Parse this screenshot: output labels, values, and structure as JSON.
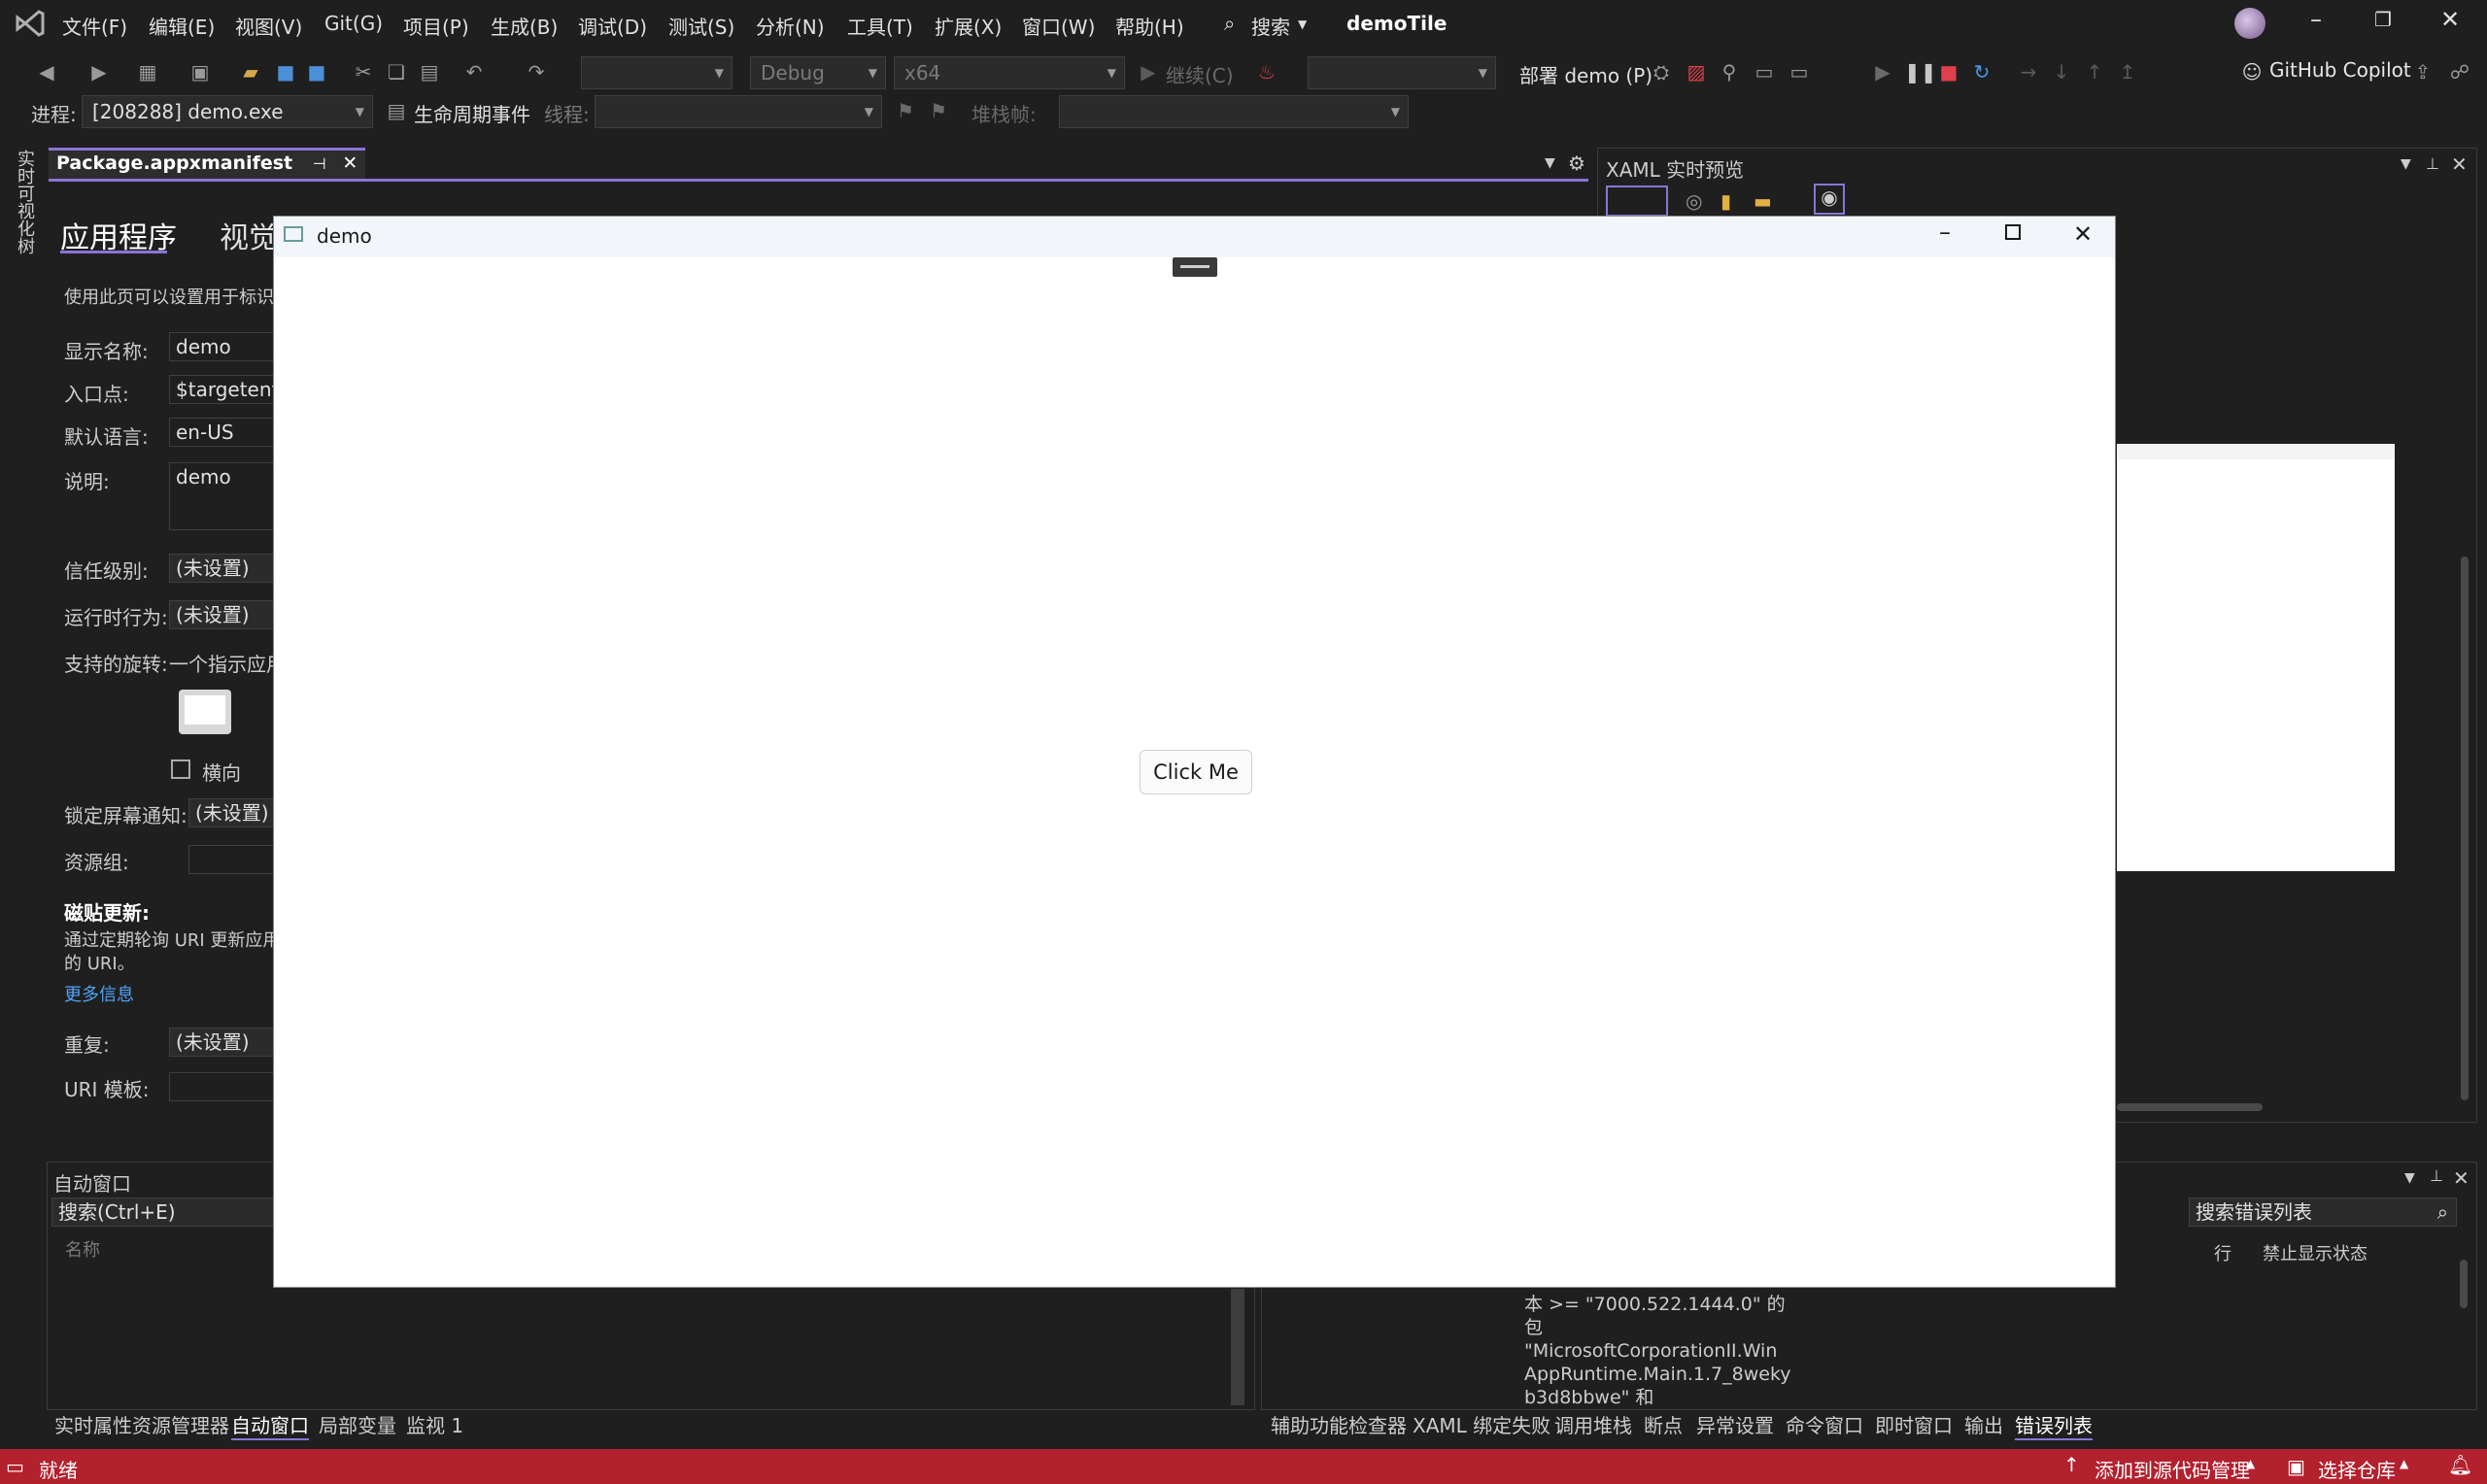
{
  "menu": {
    "items": [
      "文件(F)",
      "编辑(E)",
      "视图(V)",
      "Git(G)",
      "项目(P)",
      "生成(B)",
      "调试(D)",
      "测试(S)",
      "分析(N)",
      "工具(T)",
      "扩展(X)",
      "窗口(W)",
      "帮助(H)"
    ],
    "search_label": "搜索",
    "solution_title": "demoTile"
  },
  "toolbar": {
    "config": "Debug",
    "platform": "x64",
    "continue_label": "继续(C)",
    "deploy_label": "部署 demo (P)",
    "copilot_label": "GitHub Copilot"
  },
  "debug_bar": {
    "process_label": "进程:",
    "process_value": "[208288] demo.exe",
    "lifecycle_label": "生命周期事件",
    "thread_label": "线程:",
    "stack_label": "堆栈帧:"
  },
  "left_rail": {
    "label": "实时可视化树"
  },
  "doc_tab": {
    "title": "Package.appxmanifest"
  },
  "manifest": {
    "tab_app": "应用程序",
    "tab_visual": "视觉",
    "intro": "使用此页可以设置用于标识",
    "display_name_label": "显示名称:",
    "display_name_value": "demo",
    "entry_label": "入口点:",
    "entry_value": "$targetentr",
    "lang_label": "默认语言:",
    "lang_value": "en-US",
    "desc_label": "说明:",
    "desc_value": "demo",
    "trust_label": "信任级别:",
    "trust_value": "(未设置)",
    "runtime_label": "运行时行为:",
    "runtime_value": "(未设置)",
    "rotation_label": "支持的旋转:",
    "rotation_desc": "一个指示应用",
    "landscape_label": "横向",
    "lock_label": "锁定屏幕通知:",
    "lock_value": "(未设置)",
    "resgroup_label": "资源组:",
    "tile_update_title": "磁贴更新:",
    "tile_update_desc1": "通过定期轮询 URI 更新应用",
    "tile_update_desc2": "的 URI。",
    "more_info": "更多信息",
    "repeat_label": "重复:",
    "repeat_value": "(未设置)",
    "uri_label": "URI 模板:"
  },
  "xaml_preview": {
    "title": "XAML 实时预览"
  },
  "autos": {
    "title": "自动窗口",
    "search_placeholder": "搜索(Ctrl+E)",
    "col_name": "名称"
  },
  "error_list": {
    "search_placeholder": "搜索错误列表",
    "col_line": "行",
    "col_suppress": "禁止显示状态",
    "msg_lines": [
      "本 >= \"7000.522.1444.0\" 的",
      "包",
      "\"MicrosoftCorporationII.Win",
      "AppRuntime.Main.1.7_8weky",
      "b3d8bbwe\" 和"
    ]
  },
  "bottom_tabs_left": [
    "实时属性资源管理器",
    "自动窗口",
    "局部变量",
    "监视 1"
  ],
  "bottom_tabs_right": [
    "辅助功能检查器",
    "XAML 绑定失败",
    "调用堆栈",
    "断点",
    "异常设置",
    "命令窗口",
    "即时窗口",
    "输出",
    "错误列表"
  ],
  "app_window": {
    "title": "demo",
    "button_label": "Click Me"
  },
  "status": {
    "ready": "就绪",
    "add_source": "添加到源代码管理",
    "select_repo": "选择仓库"
  }
}
